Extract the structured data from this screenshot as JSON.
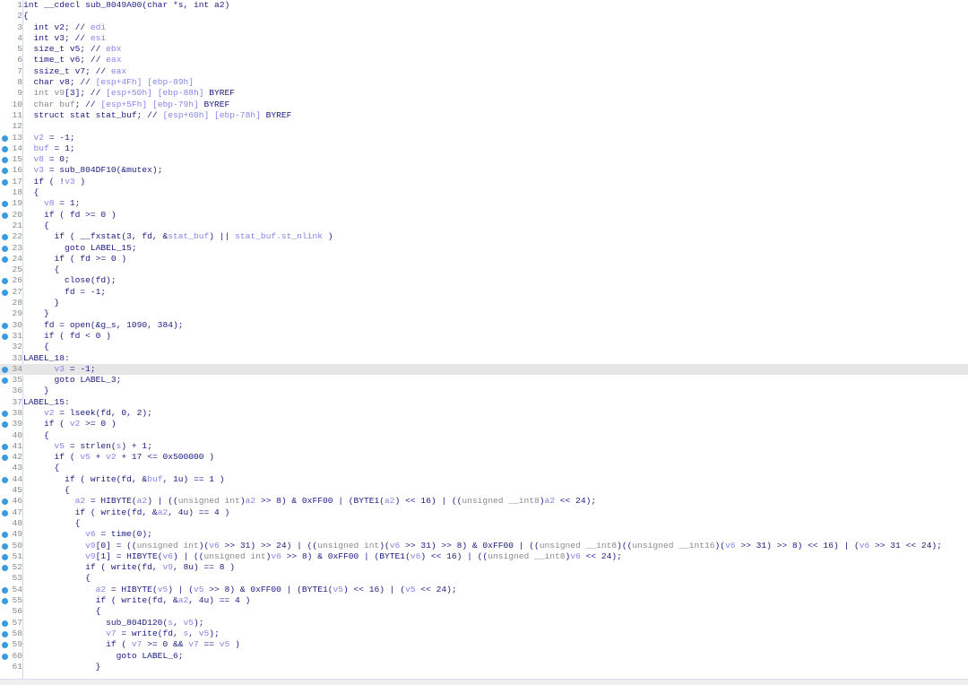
{
  "code": {
    "highlighted_line": 34,
    "colors": {
      "text": "#1c1c80",
      "variable": "#8585e8",
      "type": "#8a8a8a",
      "breakpoint": "#3a9be0",
      "highlight": "#e6e6e6"
    },
    "lines": [
      {
        "n": "1",
        "bp": false,
        "t": [
          "int __cdecl sub_8049A00(char *s, int a2)"
        ]
      },
      {
        "n": "2",
        "bp": false,
        "t": [
          "{"
        ]
      },
      {
        "n": "3",
        "bp": false,
        "t": [
          "  int v2; // ",
          [
            "v",
            "edi"
          ]
        ]
      },
      {
        "n": "4",
        "bp": false,
        "t": [
          "  int v3; // ",
          [
            "v",
            "esi"
          ]
        ]
      },
      {
        "n": "5",
        "bp": false,
        "t": [
          "  size_t v5; // ",
          [
            "v",
            "ebx"
          ]
        ]
      },
      {
        "n": "6",
        "bp": false,
        "t": [
          "  time_t v6; // ",
          [
            "v",
            "eax"
          ]
        ]
      },
      {
        "n": "7",
        "bp": false,
        "t": [
          "  ssize_t v7; // ",
          [
            "v",
            "eax"
          ]
        ]
      },
      {
        "n": "8",
        "bp": false,
        "t": [
          "  char v8; // ",
          [
            "v",
            "[esp+4Fh] [ebp-89h]"
          ]
        ]
      },
      {
        "n": "9",
        "bp": false,
        "t": [
          [
            "g",
            "  int v9"
          ],
          "[3]; // ",
          [
            "v",
            "[esp+50h] [ebp-88h] "
          ],
          "BYREF"
        ]
      },
      {
        "n": "10",
        "bp": false,
        "t": [
          [
            "g",
            "  char buf"
          ],
          "; // ",
          [
            "v",
            "[esp+5Fh] [ebp-79h] "
          ],
          "BYREF"
        ]
      },
      {
        "n": "11",
        "bp": false,
        "t": [
          "  struct stat stat_buf; // ",
          [
            "v",
            "[esp+60h] [ebp-78h] "
          ],
          "BYREF"
        ]
      },
      {
        "n": "12",
        "bp": false,
        "t": [
          ""
        ]
      },
      {
        "n": "13",
        "bp": true,
        "t": [
          [
            "v",
            "  v2"
          ],
          " = -1;"
        ]
      },
      {
        "n": "14",
        "bp": true,
        "t": [
          [
            "v",
            "  buf"
          ],
          " = 1;"
        ]
      },
      {
        "n": "15",
        "bp": true,
        "t": [
          [
            "v",
            "  v8"
          ],
          " = 0;"
        ]
      },
      {
        "n": "16",
        "bp": true,
        "t": [
          [
            "v",
            "  v3"
          ],
          " = sub_804DF10(&mutex);"
        ]
      },
      {
        "n": "17",
        "bp": true,
        "t": [
          "  if ( !",
          [
            "v",
            "v3"
          ],
          " )"
        ]
      },
      {
        "n": "18",
        "bp": false,
        "t": [
          "  {"
        ]
      },
      {
        "n": "19",
        "bp": true,
        "t": [
          [
            "v",
            "    v8"
          ],
          " = 1;"
        ]
      },
      {
        "n": "20",
        "bp": true,
        "t": [
          "    if ( fd >= 0 )"
        ]
      },
      {
        "n": "21",
        "bp": false,
        "t": [
          "    {"
        ]
      },
      {
        "n": "22",
        "bp": true,
        "t": [
          "      if ( __fxstat(3, fd, &",
          [
            "v",
            "stat_buf"
          ],
          ") || ",
          [
            "v",
            "stat_buf.st_nlink"
          ],
          " )"
        ]
      },
      {
        "n": "23",
        "bp": true,
        "t": [
          "        goto LABEL_15;"
        ]
      },
      {
        "n": "24",
        "bp": true,
        "t": [
          "      if ( fd >= 0 )"
        ]
      },
      {
        "n": "25",
        "bp": false,
        "t": [
          "      {"
        ]
      },
      {
        "n": "26",
        "bp": true,
        "t": [
          "        close(fd);"
        ]
      },
      {
        "n": "27",
        "bp": true,
        "t": [
          "        fd = -1;"
        ]
      },
      {
        "n": "28",
        "bp": false,
        "t": [
          "      }"
        ]
      },
      {
        "n": "29",
        "bp": false,
        "t": [
          "    }"
        ]
      },
      {
        "n": "30",
        "bp": true,
        "t": [
          "    fd = open(&g_s, 1090, 384);"
        ]
      },
      {
        "n": "31",
        "bp": true,
        "t": [
          "    if ( fd < 0 )"
        ]
      },
      {
        "n": "32",
        "bp": false,
        "t": [
          "    {"
        ]
      },
      {
        "n": "33",
        "bp": false,
        "t": [
          "LABEL_18:"
        ]
      },
      {
        "n": "34",
        "bp": true,
        "t": [
          "      ",
          [
            "v",
            "v3"
          ],
          " = -1;"
        ]
      },
      {
        "n": "35",
        "bp": true,
        "t": [
          "      goto LABEL_3;"
        ]
      },
      {
        "n": "36",
        "bp": false,
        "t": [
          "    }"
        ]
      },
      {
        "n": "37",
        "bp": false,
        "t": [
          "LABEL_15:"
        ]
      },
      {
        "n": "38",
        "bp": true,
        "t": [
          "    ",
          [
            "v",
            "v2"
          ],
          " = lseek(fd, 0, 2);"
        ]
      },
      {
        "n": "39",
        "bp": true,
        "t": [
          "    if ( ",
          [
            "v",
            "v2"
          ],
          " >= 0 )"
        ]
      },
      {
        "n": "40",
        "bp": false,
        "t": [
          "    {"
        ]
      },
      {
        "n": "41",
        "bp": true,
        "t": [
          "      ",
          [
            "v",
            "v5"
          ],
          " = strlen(",
          [
            "v",
            "s"
          ],
          ") + 1;"
        ]
      },
      {
        "n": "42",
        "bp": true,
        "t": [
          "      if ( ",
          [
            "v",
            "v5"
          ],
          " + ",
          [
            "v",
            "v2"
          ],
          " + 17 <= 0x500000 )"
        ]
      },
      {
        "n": "43",
        "bp": false,
        "t": [
          "      {"
        ]
      },
      {
        "n": "44",
        "bp": true,
        "t": [
          "        if ( write(fd, &",
          [
            "v",
            "buf"
          ],
          ", 1u) == 1 )"
        ]
      },
      {
        "n": "45",
        "bp": false,
        "t": [
          "        {"
        ]
      },
      {
        "n": "46",
        "bp": true,
        "t": [
          "          ",
          [
            "v",
            "a2"
          ],
          " = HIBYTE(",
          [
            "v",
            "a2"
          ],
          ") | ((",
          [
            "g",
            "unsigned int"
          ],
          ")",
          [
            "v",
            "a2"
          ],
          " >> 8) & 0xFF00 | (BYTE1(",
          [
            "v",
            "a2"
          ],
          ") << 16) | ((",
          [
            "g",
            "unsigned __int8"
          ],
          ")",
          [
            "v",
            "a2"
          ],
          " << 24);"
        ]
      },
      {
        "n": "47",
        "bp": true,
        "t": [
          "          if ( write(fd, &",
          [
            "v",
            "a2"
          ],
          ", 4u) == 4 )"
        ]
      },
      {
        "n": "48",
        "bp": false,
        "t": [
          "          {"
        ]
      },
      {
        "n": "49",
        "bp": true,
        "t": [
          "            ",
          [
            "v",
            "v6"
          ],
          " = time(0);"
        ]
      },
      {
        "n": "50",
        "bp": true,
        "t": [
          "            ",
          [
            "v",
            "v9"
          ],
          "[0] = ((",
          [
            "g",
            "unsigned int"
          ],
          ")(",
          [
            "v",
            "v6"
          ],
          " >> 31) >> 24) | ((",
          [
            "g",
            "unsigned int"
          ],
          ")(",
          [
            "v",
            "v6"
          ],
          " >> 31) >> 8) & 0xFF00 | ((",
          [
            "g",
            "unsigned __int8"
          ],
          ")((",
          [
            "g",
            "unsigned __int16"
          ],
          ")(",
          [
            "v",
            "v6"
          ],
          " >> 31) >> 8) << 16) | (",
          [
            "v",
            "v6"
          ],
          " >> 31 << 24);"
        ]
      },
      {
        "n": "51",
        "bp": true,
        "t": [
          "            ",
          [
            "v",
            "v9"
          ],
          "[1] = HIBYTE(",
          [
            "v",
            "v6"
          ],
          ") | ((",
          [
            "g",
            "unsigned int"
          ],
          ")",
          [
            "v",
            "v6"
          ],
          " >> 8) & 0xFF00 | (BYTE1(",
          [
            "v",
            "v6"
          ],
          ") << 16) | ((",
          [
            "g",
            "unsigned __int8"
          ],
          ")",
          [
            "v",
            "v6"
          ],
          " << 24);"
        ]
      },
      {
        "n": "52",
        "bp": true,
        "t": [
          "            if ( write(fd, ",
          [
            "v",
            "v9"
          ],
          ", 8u) == 8 )"
        ]
      },
      {
        "n": "53",
        "bp": false,
        "t": [
          "            {"
        ]
      },
      {
        "n": "54",
        "bp": true,
        "t": [
          "              ",
          [
            "v",
            "a2"
          ],
          " = HIBYTE(",
          [
            "v",
            "v5"
          ],
          ") | (",
          [
            "v",
            "v5"
          ],
          " >> 8) & 0xFF00 | (BYTE1(",
          [
            "v",
            "v5"
          ],
          ") << 16) | (",
          [
            "v",
            "v5"
          ],
          " << 24);"
        ]
      },
      {
        "n": "55",
        "bp": true,
        "t": [
          "              if ( write(fd, &",
          [
            "v",
            "a2"
          ],
          ", 4u) == 4 )"
        ]
      },
      {
        "n": "56",
        "bp": false,
        "t": [
          "              {"
        ]
      },
      {
        "n": "57",
        "bp": true,
        "t": [
          "                sub_804D120(",
          [
            "v",
            "s"
          ],
          ", ",
          [
            "v",
            "v5"
          ],
          ");"
        ]
      },
      {
        "n": "58",
        "bp": true,
        "t": [
          "                ",
          [
            "v",
            "v7"
          ],
          " = write(fd, ",
          [
            "v",
            "s"
          ],
          ", ",
          [
            "v",
            "v5"
          ],
          ");"
        ]
      },
      {
        "n": "59",
        "bp": true,
        "t": [
          "                if ( ",
          [
            "v",
            "v7"
          ],
          " >= 0 && ",
          [
            "v",
            "v7"
          ],
          " == ",
          [
            "v",
            "v5"
          ],
          " )"
        ]
      },
      {
        "n": "60",
        "bp": true,
        "t": [
          "                  goto LABEL_6;"
        ]
      },
      {
        "n": "61",
        "bp": false,
        "t": [
          "              }"
        ]
      }
    ]
  }
}
